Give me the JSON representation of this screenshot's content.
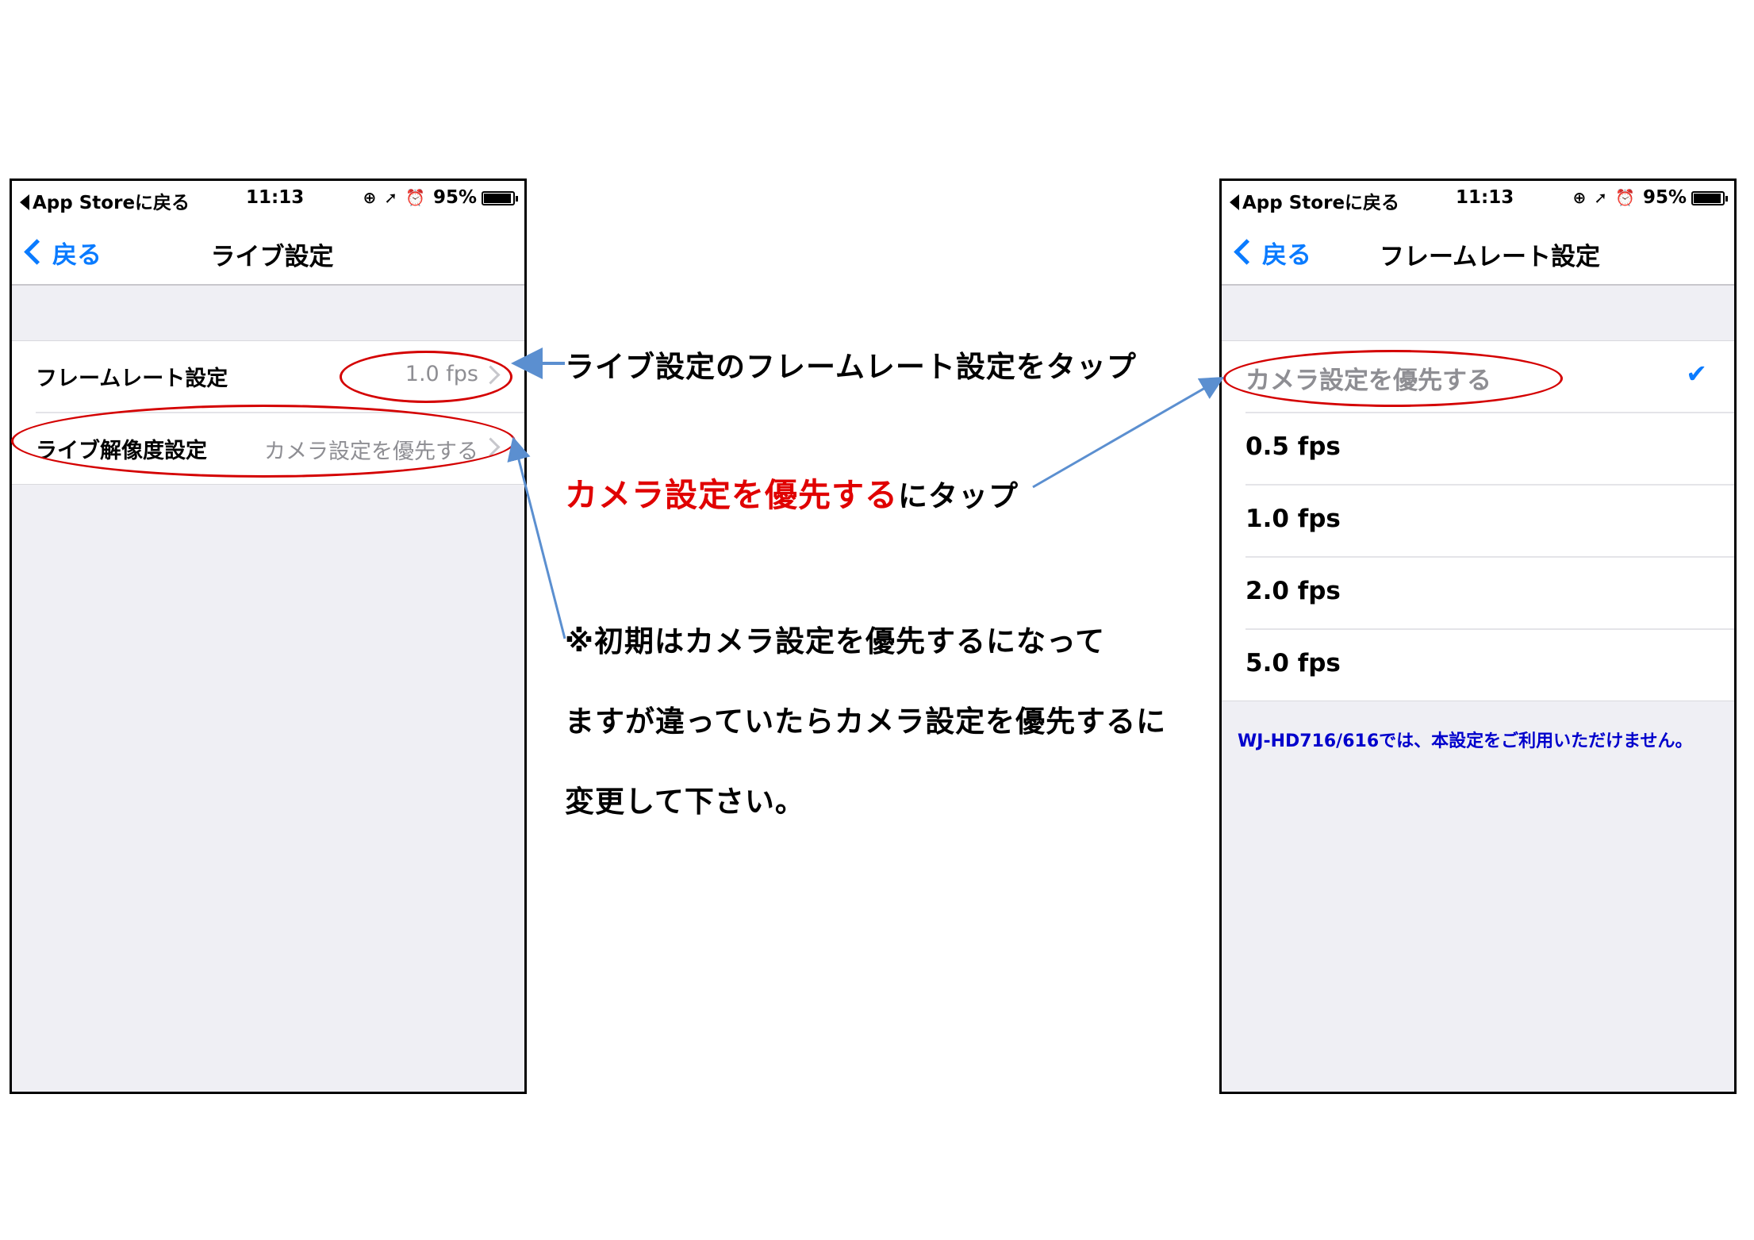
{
  "left_phone": {
    "status_bar": {
      "back_app": "App Storeに戻る",
      "time": "11:13",
      "icons": [
        "rotation-lock-icon",
        "location-arrow-icon",
        "alarm-icon"
      ],
      "battery": "95%",
      "battery_level": 0.95
    },
    "nav": {
      "back_label": "戻る",
      "title": "ライブ設定"
    },
    "rows": [
      {
        "label": "フレームレート設定",
        "value": "1.0 fps"
      },
      {
        "label": "ライブ解像度設定",
        "value": "カメラ設定を優先する"
      }
    ]
  },
  "right_phone": {
    "status_bar": {
      "back_app": "App Storeに戻る",
      "time": "11:13",
      "icons": [
        "rotation-lock-icon",
        "location-arrow-icon",
        "alarm-icon"
      ],
      "battery": "95%",
      "battery_level": 0.95
    },
    "nav": {
      "back_label": "戻る",
      "title": "フレームレート設定"
    },
    "options": [
      {
        "label": "カメラ設定を優先する",
        "selected": true
      },
      {
        "label": "0.5 fps",
        "selected": false
      },
      {
        "label": "1.0 fps",
        "selected": false
      },
      {
        "label": "2.0 fps",
        "selected": false
      },
      {
        "label": "5.0 fps",
        "selected": false
      }
    ],
    "checkmark": "✔",
    "footnote": "WJ-HD716/616では、本設定をご利用いただけません。"
  },
  "annotations": {
    "step1": "ライブ設定のフレームレート設定をタップ",
    "step2_highlight": "カメラ設定を優先する",
    "step2_rest": "にタップ",
    "note_line1": "※初期はカメラ設定を優先するになって",
    "note_line2": "ますが違っていたらカメラ設定を優先するに",
    "note_line3": "変更して下さい。"
  },
  "colors": {
    "ios_blue": "#0a7bff",
    "annotation_red": "#e00000",
    "arrow_blue": "#5b8fd0",
    "footnote_blue": "#0000cc"
  }
}
